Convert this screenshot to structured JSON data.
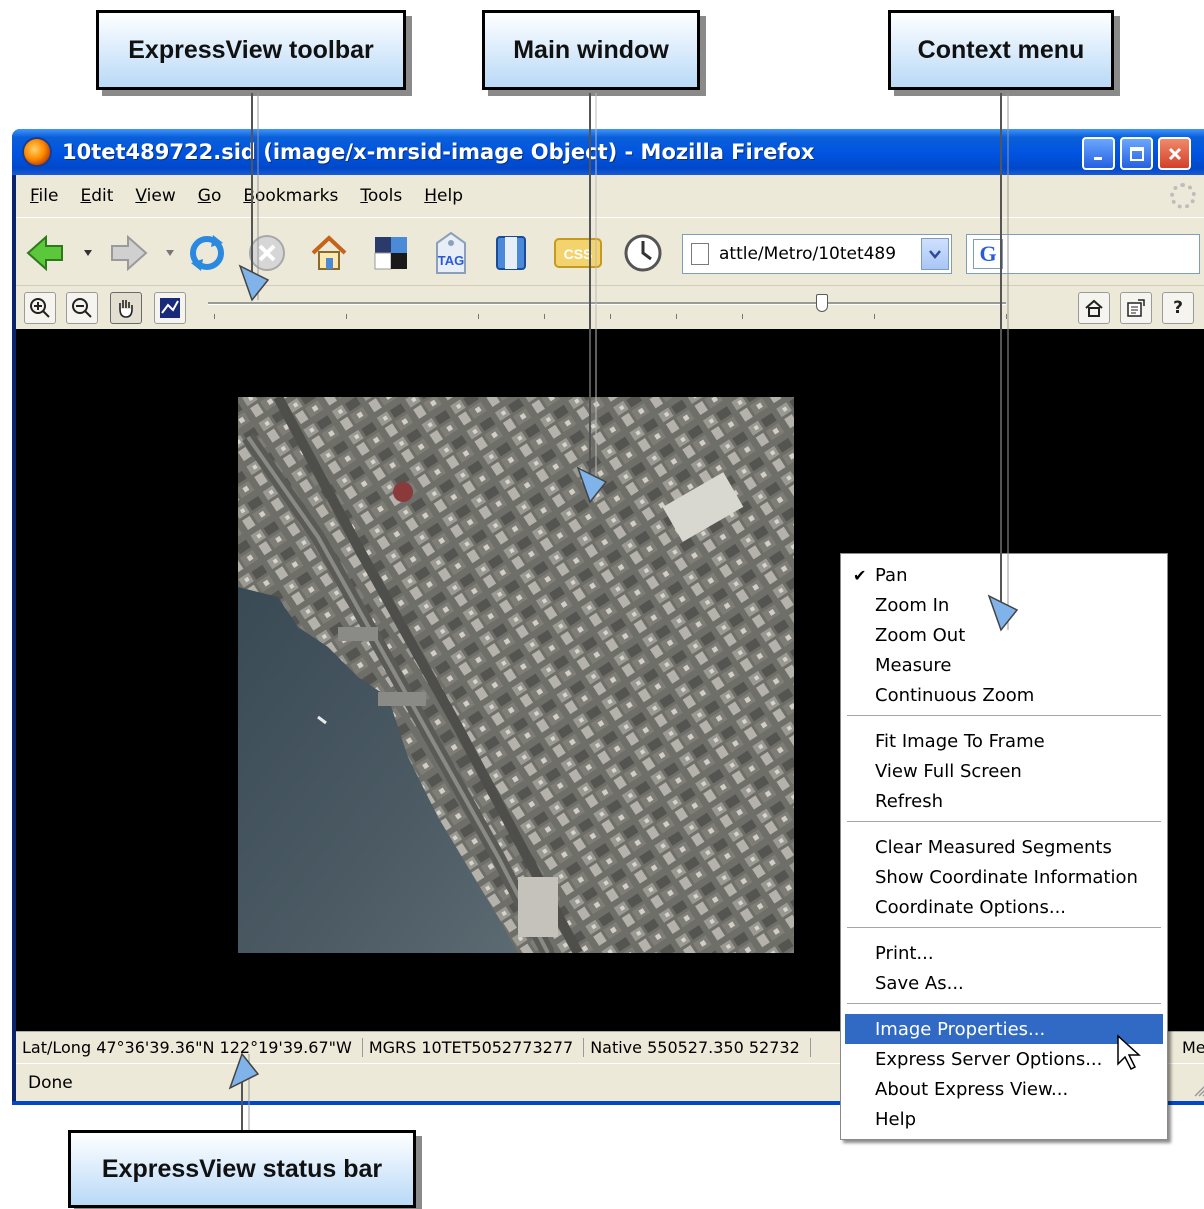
{
  "callouts": {
    "toolbar": "ExpressView toolbar",
    "main_window": "Main window",
    "context_menu": "Context menu",
    "status_bar": "ExpressView status bar"
  },
  "window": {
    "title": "10tet489722.sid (image/x-mrsid-image Object) - Mozilla Firefox",
    "controls": [
      "minimize-icon",
      "maximize-icon",
      "close-icon"
    ]
  },
  "menubar": {
    "items": [
      "File",
      "Edit",
      "View",
      "Go",
      "Bookmarks",
      "Tools",
      "Help"
    ]
  },
  "navbar": {
    "icons": [
      "back-arrow-icon",
      "forward-arrow-icon",
      "reload-icon",
      "stop-icon",
      "home-icon",
      "tile-icon",
      "tag-icon",
      "bookmark-icon",
      "css-icon",
      "history-clock-icon"
    ],
    "tag_label": "TAG",
    "css_label": "CSS",
    "url": "attle/Metro/10tet489",
    "search_engine_letter": "G",
    "search_value": ""
  },
  "ev_toolbar": {
    "buttons": [
      "zoom-in-icon",
      "zoom-out-icon",
      "pan-hand-icon",
      "measure-icon"
    ],
    "right_buttons": [
      "home-icon",
      "properties-icon",
      "help-icon"
    ],
    "help_label": "?",
    "zoom_level": 0.77
  },
  "ev_status": {
    "latlong": "Lat/Long 47°36'39.36\"N 122°19'39.67\"W",
    "mgrs": "MGRS 10TET5052773277",
    "native": "Native 550527.350 52732",
    "measure": "Mea"
  },
  "statusbar": {
    "text": "Done"
  },
  "context_menu": {
    "groups": [
      [
        {
          "label": "Pan",
          "checked": true
        },
        {
          "label": "Zoom In"
        },
        {
          "label": "Zoom Out"
        },
        {
          "label": "Measure"
        },
        {
          "label": "Continuous Zoom"
        }
      ],
      [
        {
          "label": "Fit Image To Frame"
        },
        {
          "label": "View Full Screen"
        },
        {
          "label": "Refresh"
        }
      ],
      [
        {
          "label": "Clear Measured Segments"
        },
        {
          "label": "Show Coordinate Information"
        },
        {
          "label": "Coordinate Options..."
        }
      ],
      [
        {
          "label": "Print..."
        },
        {
          "label": "Save As..."
        }
      ],
      [
        {
          "label": "Image Properties...",
          "selected": true
        },
        {
          "label": "Express Server Options..."
        },
        {
          "label": "About Express View..."
        },
        {
          "label": "Help"
        }
      ]
    ],
    "check_glyph": "✔"
  },
  "colors": {
    "titlebar": "#0053e1",
    "chrome": "#ece9d8",
    "menu_highlight": "#316ac5",
    "callout_fill": "#b9d9f6"
  }
}
